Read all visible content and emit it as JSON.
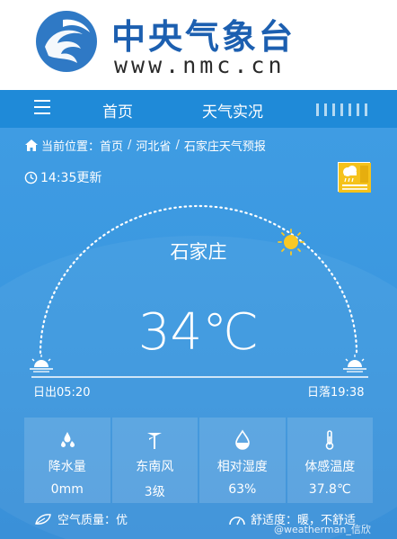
{
  "header": {
    "logo_text": "中央气象台",
    "logo_url": "www.nmc.cn"
  },
  "nav": {
    "home": "首页",
    "live": "天气实况"
  },
  "breadcrumb": {
    "prefix": "当前位置：",
    "items": [
      "首页",
      "河北省",
      "石家庄天气预报"
    ]
  },
  "update_time": "14:35更新",
  "warning": {
    "label": "暴雨",
    "color": "#f5c21b"
  },
  "city": "石家庄",
  "temperature": "34℃",
  "sun": {
    "sunrise": "日出05:20",
    "sunset": "日落19:38"
  },
  "stats": [
    {
      "label": "降水量",
      "value": "0mm",
      "icon": "rain-drops-icon"
    },
    {
      "label": "东南风",
      "value": "3级",
      "icon": "wind-turbine-icon"
    },
    {
      "label": "相对湿度",
      "value": "63%",
      "icon": "humidity-icon"
    },
    {
      "label": "体感温度",
      "value": "37.8℃",
      "icon": "thermometer-icon"
    }
  ],
  "air_quality": "空气质量：优",
  "comfort": "舒适度：暖，不舒适",
  "watermark": "@weatherman_信欣"
}
